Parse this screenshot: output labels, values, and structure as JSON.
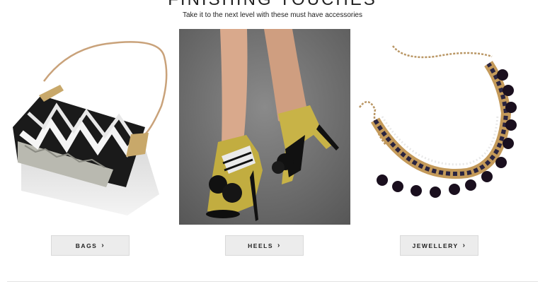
{
  "section": {
    "title": "FINISHING TOUCHES",
    "subtitle": "Take it to the next level with these must have accessories"
  },
  "products": [
    {
      "label": "BAGS",
      "icon": "chevron-right-icon"
    },
    {
      "label": "HEELS",
      "icon": "chevron-right-icon"
    },
    {
      "label": "JEWELLERY",
      "icon": "chevron-right-icon"
    }
  ],
  "colors": {
    "button_bg": "#ececec",
    "text": "#222222"
  }
}
